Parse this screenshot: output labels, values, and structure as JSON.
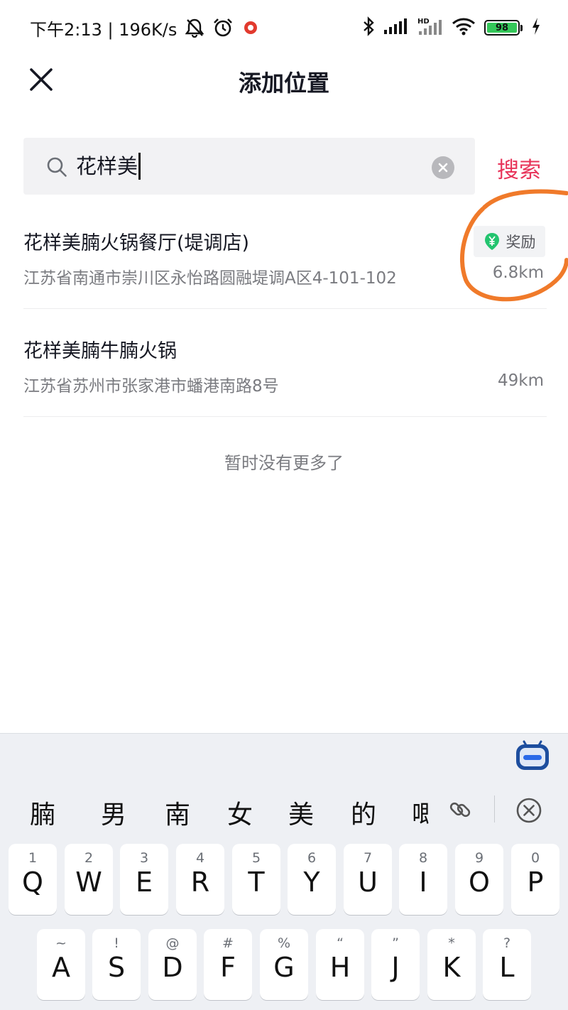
{
  "status_bar": {
    "time_text": "下午2:13 | 196K/s",
    "battery": "98"
  },
  "header": {
    "title": "添加位置"
  },
  "search": {
    "value": "花样美",
    "submit_label": "搜索"
  },
  "results": [
    {
      "name": "花样美腩火锅餐厅(堤调店)",
      "address": "江苏省南通市崇川区永怡路圆融堤调A区4-101-102",
      "distance": "6.8km",
      "badge": "奖励"
    },
    {
      "name": "花样美腩牛腩火锅",
      "address": "江苏省苏州市张家港市蟠港南路8号",
      "distance": "49km"
    }
  ],
  "end_text": "暂时没有更多了",
  "keyboard": {
    "candidates": [
      "腩",
      "男",
      "南",
      "女",
      "美",
      "的",
      "唧"
    ],
    "row1": [
      {
        "hint": "1",
        "letter": "Q"
      },
      {
        "hint": "2",
        "letter": "W"
      },
      {
        "hint": "3",
        "letter": "E"
      },
      {
        "hint": "4",
        "letter": "R"
      },
      {
        "hint": "5",
        "letter": "T"
      },
      {
        "hint": "6",
        "letter": "Y"
      },
      {
        "hint": "7",
        "letter": "U"
      },
      {
        "hint": "8",
        "letter": "I"
      },
      {
        "hint": "9",
        "letter": "O"
      },
      {
        "hint": "0",
        "letter": "P"
      }
    ],
    "row2": [
      {
        "hint": "~",
        "letter": "A"
      },
      {
        "hint": "!",
        "letter": "S"
      },
      {
        "hint": "@",
        "letter": "D"
      },
      {
        "hint": "#",
        "letter": "F"
      },
      {
        "hint": "%",
        "letter": "G"
      },
      {
        "hint": "“",
        "letter": "H"
      },
      {
        "hint": "”",
        "letter": "J"
      },
      {
        "hint": "*",
        "letter": "K"
      },
      {
        "hint": "?",
        "letter": "L"
      }
    ]
  },
  "colors": {
    "accent": "#e8345a",
    "annotation": "#f07a2a",
    "reward_icon": "#23c46f"
  }
}
